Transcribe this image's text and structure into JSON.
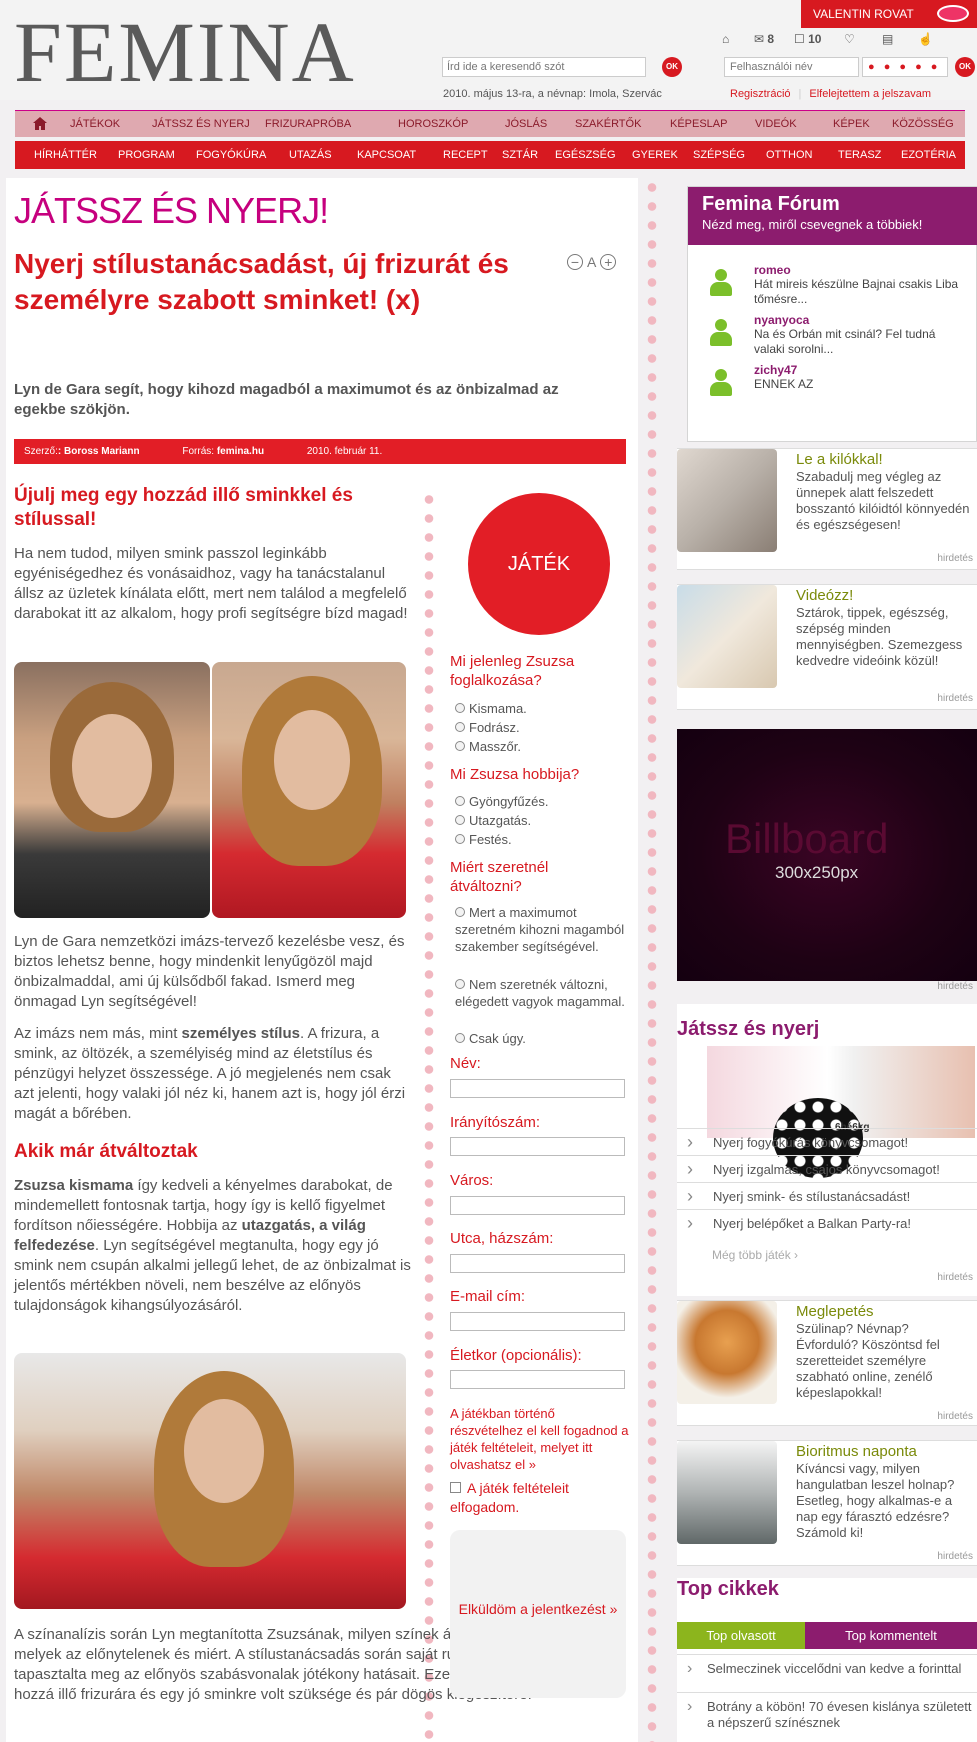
{
  "header": {
    "logo": "FEMINA",
    "rovat": "VALENTIN ROVAT",
    "msg_count": "8",
    "comment_count": "10",
    "search_placeholder": "Írd ide a keresendő szót",
    "ok": "OK",
    "date_note": "2010. május 13-ra, a névnap: Imola, Szervác",
    "user_placeholder": "Felhasználói név",
    "password_mask": "● ● ● ● ●",
    "register": "Regisztráció",
    "forgot": "Elfelejtettem a jelszavam"
  },
  "nav1": [
    "JÁTÉKOK",
    "JÁTSSZ ÉS NYERJ",
    "FRIZURAPRÓBA",
    "HOROSZKÓP",
    "JÓSLÁS",
    "SZAKÉRTŐK",
    "KÉPESLAP",
    "VIDEÓK",
    "KÉPEK",
    "KÖZÖSSÉG"
  ],
  "nav2": [
    "HÍRHÁTTÉR",
    "PROGRAM",
    "FOGYÓKÚRA",
    "UTAZÁS",
    "KAPCSOAT",
    "RECEPT",
    "SZTÁR",
    "EGÉSZSÉG",
    "GYEREK",
    "SZÉPSÉG",
    "OTTHON",
    "TERASZ",
    "EZOTÉRIA"
  ],
  "article": {
    "section": "JÁTSSZ ÉS NYERJ!",
    "title": "Nyerj stílustanácsadást, új frizurát és személyre szabott sminket! (x)",
    "zoom_minus": "−",
    "zoom_a": "A",
    "zoom_plus": "+",
    "lead": "Lyn de Gara segít, hogy kihozd magadból a maximumot és az önbizalmad az egekbe szökjön.",
    "author_label": "Szerző:",
    "author": ": Boross Mariann",
    "source_label": "Forrás:",
    "source": "femina.hu",
    "date": "2010. február 11.",
    "h1": "Újulj meg egy hozzád illő sminkkel és stílussal!",
    "p1": "Ha nem tudod, milyen smink passzol leginkább egyéniségedhez és vonásaidhoz, vagy ha tanácstalanul állsz az üzletek kínálata előtt, mert nem találod a megfelelő darabokat itt az alkalom, hogy profi segítségre bízd magad!",
    "p2": "Lyn de Gara nemzetközi imázs-tervező kezelésbe vesz, és biztos lehetsz benne, hogy mindenkit lenyűgözöl majd önbizalmaddal, ami új külsődből fakad. Ismerd meg önmagad Lyn segítségével!",
    "p3a": "Az imázs nem más, mint ",
    "p3b": "személyes stílus",
    "p3c": ". A frizura, a smink, az öltözék, a személyiség mind az életstílus és pénzügyi helyzet összessége. A jó megjelenés nem csak azt jelenti, hogy valaki jól néz ki, hanem azt is, hogy jól érzi magát a bőrében.",
    "h2": "Akik már átváltoztak",
    "p4a": "Zsuzsa kismama",
    "p4b": " így kedveli a kényelmes darabokat, de mindemellett fontosnak tartja, hogy így is kellő figyelmet fordítson nőiességére. Hobbija az ",
    "p4c": "utazgatás, a világ felfedezése",
    "p4d": ". Lyn segítségével megtanulta, hogy egy jó smink nem csupán alkalmi jellegű lehet, de az önbizalmat is jelentős mértékben növeli, nem beszélve az előnyös tulajdonságok kihangsúlyozásáról.",
    "p5": "A színanalízis során Lyn megtanította Zsuzsának, milyen színek állnak neki igazán jól, melyek az előnytelenek és miért. A stílustanácsadás során saját ruhájának átalakításával tapasztalta meg az előnyös szabásvonalak jótékony hatásait. Ezek után már csak egy hozzá illő frizurára és egy jó sminkre volt szüksége és pár dögös kiegészítőre."
  },
  "game": {
    "badge": "JÁTÉK",
    "q1": "Mi jelenleg Zsuzsa foglalkozása?",
    "q1_opts": [
      "Kismama.",
      "Fodrász.",
      "Masszőr."
    ],
    "q2": "Mi Zsuzsa hobbija?",
    "q2_opts": [
      "Gyöngyfűzés.",
      "Utazgatás.",
      "Festés."
    ],
    "q3": "Miért szeretnél átváltozni?",
    "q3_opts": [
      "Mert a maximumot szeretném kihozni magamból szakember segítségével.",
      "Nem szeretnék változni, elégedett vagyok magammal.",
      "Csak úgy."
    ],
    "fields": [
      "Név:",
      "Irányítószám:",
      "Város:",
      "Utca, házszám:",
      "E-mail cím:",
      "Életkor (opcionális):"
    ],
    "terms": "A játékban történő részvételhez el kell fogadnod a játék feltételeit, melyet itt olvashatsz el »",
    "accept": "A játék feltételeit elfogadom.",
    "submit": "Elküldöm a jelentkezést »"
  },
  "forum": {
    "title": "Femina Fórum",
    "subtitle": "Nézd meg, miről csevegnek a többiek!",
    "posts": [
      {
        "user": "romeo",
        "text": "Hát mireis készülne Bajnai csakis Liba tőmésre..."
      },
      {
        "user": "nyanyoca",
        "text": "Na és Orbán mit csinál? Fel tudná valaki sorolni..."
      },
      {
        "user": "zichy47",
        "text": "ENNEK AZ"
      }
    ]
  },
  "promos": [
    {
      "title": "Le a kilókkal!",
      "desc": "Szabadulj meg végleg az ünnepek alatt felszedett bosszantó kilóidtól könnyedén és egészségesen!",
      "ad": "hirdetés"
    },
    {
      "title": "Videózz!",
      "desc": "Sztárok, tippek, egészség, szépség minden mennyiségben. Szemezgess kedvedre videóink közül!",
      "ad": "hirdetés"
    },
    {
      "title": "Meglepetés",
      "desc": "Szülinap? Névnap? Évforduló? Köszöntsd fel szeretteidet személyre szabható online, zenélő képeslapokkal!",
      "ad": "hirdetés"
    },
    {
      "title": "Bioritmus naponta",
      "desc": "Kíváncsi vagy, milyen hangulatban leszel holnap? Esetleg, hogy alkalmas-e a nap egy fárasztó edzésre? Számold ki!",
      "ad": "hirdetés"
    }
  ],
  "billboard": {
    "label": "Billboard",
    "size": "300x250px",
    "ad": "hirdetés"
  },
  "jny": {
    "title": "Játssz és nyerj",
    "items": [
      "Nyerj fogyókúrás könyvcsomagot!",
      "Nyerj izgalmas, csajos könyvcsomagot!",
      "Nyerj smink- és stílustanácsadást!",
      "Nyerj belépőket a Balkan Party-ra!"
    ],
    "more": "Még több játék  ›",
    "ad": "hirdetés",
    "img_text": "6hé6kg"
  },
  "topcikk": {
    "title": "Top cikkek",
    "tab1": "Top olvasott",
    "tab2": "Top kommentelt",
    "items": [
      "Selmeczinek viccelődni van kedve a forinttal",
      "Botrány a köbön! 70 évesen kislánya született a népszerű színésznek"
    ]
  }
}
